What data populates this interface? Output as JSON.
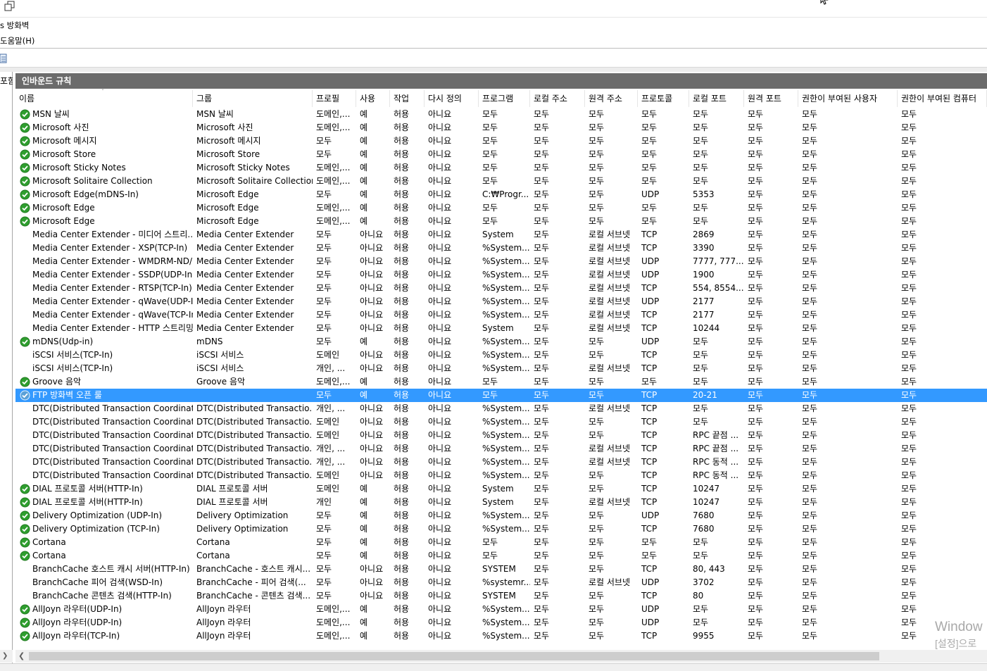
{
  "window": {
    "app_title": "s 방화벽",
    "menu_help": "도움말(H)",
    "left_pane_label": "포함"
  },
  "panel": {
    "title": "인바운드 규칙"
  },
  "columns": [
    "이름",
    "그룹",
    "프로필",
    "사용",
    "작업",
    "다시 정의",
    "프로그램",
    "로컬 주소",
    "원격 주소",
    "프로토콜",
    "로컬 포트",
    "원격 포트",
    "권한이 부여된 사용자",
    "권한이 부여된 컴퓨터"
  ],
  "rows": [
    {
      "enabled": true,
      "cells": [
        "MSN 날씨",
        "MSN 날씨",
        "도메인,...",
        "예",
        "허용",
        "아니요",
        "모두",
        "모두",
        "모두",
        "모두",
        "모두",
        "모두",
        "모두",
        "모두"
      ]
    },
    {
      "enabled": true,
      "cells": [
        "Microsoft 사진",
        "Microsoft 사진",
        "도메인,...",
        "예",
        "허용",
        "아니요",
        "모두",
        "모두",
        "모두",
        "모두",
        "모두",
        "모두",
        "모두",
        "모두"
      ]
    },
    {
      "enabled": true,
      "cells": [
        "Microsoft 메시지",
        "Microsoft 메시지",
        "모두",
        "예",
        "허용",
        "아니요",
        "모두",
        "모두",
        "모두",
        "모두",
        "모두",
        "모두",
        "모두",
        "모두"
      ]
    },
    {
      "enabled": true,
      "cells": [
        "Microsoft Store",
        "Microsoft Store",
        "모두",
        "예",
        "허용",
        "아니요",
        "모두",
        "모두",
        "모두",
        "모두",
        "모두",
        "모두",
        "모두",
        "모두"
      ]
    },
    {
      "enabled": true,
      "cells": [
        "Microsoft Sticky Notes",
        "Microsoft Sticky Notes",
        "도메인,...",
        "예",
        "허용",
        "아니요",
        "모두",
        "모두",
        "모두",
        "모두",
        "모두",
        "모두",
        "모두",
        "모두"
      ]
    },
    {
      "enabled": true,
      "cells": [
        "Microsoft Solitaire Collection",
        "Microsoft Solitaire Collection",
        "도메인,...",
        "예",
        "허용",
        "아니요",
        "모두",
        "모두",
        "모두",
        "모두",
        "모두",
        "모두",
        "모두",
        "모두"
      ]
    },
    {
      "enabled": true,
      "cells": [
        "Microsoft Edge(mDNS-In)",
        "Microsoft Edge",
        "모두",
        "예",
        "허용",
        "아니요",
        "C:₩Progr...",
        "모두",
        "모두",
        "UDP",
        "5353",
        "모두",
        "모두",
        "모두"
      ]
    },
    {
      "enabled": true,
      "cells": [
        "Microsoft Edge",
        "Microsoft Edge",
        "도메인,...",
        "예",
        "허용",
        "아니요",
        "모두",
        "모두",
        "모두",
        "모두",
        "모두",
        "모두",
        "모두",
        "모두"
      ]
    },
    {
      "enabled": true,
      "cells": [
        "Microsoft Edge",
        "Microsoft Edge",
        "도메인,...",
        "예",
        "허용",
        "아니요",
        "모두",
        "모두",
        "모두",
        "모두",
        "모두",
        "모두",
        "모두",
        "모두"
      ]
    },
    {
      "enabled": false,
      "cells": [
        "Media Center Extender - 미디어 스트리...",
        "Media Center Extender",
        "모두",
        "아니요",
        "허용",
        "아니요",
        "System",
        "모두",
        "로컬 서브넷",
        "TCP",
        "2869",
        "모두",
        "모두",
        "모두"
      ]
    },
    {
      "enabled": false,
      "cells": [
        "Media Center Extender - XSP(TCP-In)",
        "Media Center Extender",
        "모두",
        "아니요",
        "허용",
        "아니요",
        "%System...",
        "모두",
        "로컬 서브넷",
        "TCP",
        "3390",
        "모두",
        "모두",
        "모두"
      ]
    },
    {
      "enabled": false,
      "cells": [
        "Media Center Extender - WMDRM-ND/...",
        "Media Center Extender",
        "모두",
        "아니요",
        "허용",
        "아니요",
        "%System...",
        "모두",
        "로컬 서브넷",
        "UDP",
        "7777, 777...",
        "모두",
        "모두",
        "모두"
      ]
    },
    {
      "enabled": false,
      "cells": [
        "Media Center Extender - SSDP(UDP-In)",
        "Media Center Extender",
        "모두",
        "아니요",
        "허용",
        "아니요",
        "%System...",
        "모두",
        "로컬 서브넷",
        "UDP",
        "1900",
        "모두",
        "모두",
        "모두"
      ]
    },
    {
      "enabled": false,
      "cells": [
        "Media Center Extender - RTSP(TCP-In)",
        "Media Center Extender",
        "모두",
        "아니요",
        "허용",
        "아니요",
        "%System...",
        "모두",
        "로컬 서브넷",
        "TCP",
        "554, 8554...",
        "모두",
        "모두",
        "모두"
      ]
    },
    {
      "enabled": false,
      "cells": [
        "Media Center Extender - qWave(UDP-In)",
        "Media Center Extender",
        "모두",
        "아니요",
        "허용",
        "아니요",
        "%System...",
        "모두",
        "로컬 서브넷",
        "UDP",
        "2177",
        "모두",
        "모두",
        "모두"
      ]
    },
    {
      "enabled": false,
      "cells": [
        "Media Center Extender - qWave(TCP-In)",
        "Media Center Extender",
        "모두",
        "아니요",
        "허용",
        "아니요",
        "%System...",
        "모두",
        "로컬 서브넷",
        "TCP",
        "2177",
        "모두",
        "모두",
        "모두"
      ]
    },
    {
      "enabled": false,
      "cells": [
        "Media Center Extender - HTTP 스트리밍...",
        "Media Center Extender",
        "모두",
        "아니요",
        "허용",
        "아니요",
        "System",
        "모두",
        "로컬 서브넷",
        "TCP",
        "10244",
        "모두",
        "모두",
        "모두"
      ]
    },
    {
      "enabled": true,
      "cells": [
        "mDNS(Udp-in)",
        "mDNS",
        "모두",
        "예",
        "허용",
        "아니요",
        "%System...",
        "모두",
        "모두",
        "UDP",
        "모두",
        "모두",
        "모두",
        "모두"
      ]
    },
    {
      "enabled": false,
      "cells": [
        "iSCSI 서비스(TCP-In)",
        "iSCSI 서비스",
        "도메인",
        "아니요",
        "허용",
        "아니요",
        "%System...",
        "모두",
        "모두",
        "TCP",
        "모두",
        "모두",
        "모두",
        "모두"
      ]
    },
    {
      "enabled": false,
      "cells": [
        "iSCSI 서비스(TCP-In)",
        "iSCSI 서비스",
        "개인, ...",
        "아니요",
        "허용",
        "아니요",
        "%System...",
        "모두",
        "로컬 서브넷",
        "TCP",
        "모두",
        "모두",
        "모두",
        "모두"
      ]
    },
    {
      "enabled": true,
      "cells": [
        "Groove 음악",
        "Groove 음악",
        "도메인,...",
        "예",
        "허용",
        "아니요",
        "모두",
        "모두",
        "모두",
        "모두",
        "모두",
        "모두",
        "모두",
        "모두"
      ]
    },
    {
      "enabled": true,
      "selected": true,
      "cells": [
        "FTP 방화벽 오픈 룰",
        "",
        "모두",
        "예",
        "허용",
        "아니요",
        "모두",
        "모두",
        "모두",
        "TCP",
        "20-21",
        "모두",
        "모두",
        "모두"
      ]
    },
    {
      "enabled": false,
      "cells": [
        "DTC(Distributed Transaction Coordinato...",
        "DTC(Distributed Transactio...",
        "개인, ...",
        "아니요",
        "허용",
        "아니요",
        "%System...",
        "모두",
        "로컬 서브넷",
        "TCP",
        "모두",
        "모두",
        "모두",
        "모두"
      ]
    },
    {
      "enabled": false,
      "cells": [
        "DTC(Distributed Transaction Coordinato...",
        "DTC(Distributed Transactio...",
        "도메인",
        "아니요",
        "허용",
        "아니요",
        "%System...",
        "모두",
        "모두",
        "TCP",
        "모두",
        "모두",
        "모두",
        "모두"
      ]
    },
    {
      "enabled": false,
      "cells": [
        "DTC(Distributed Transaction Coordinato...",
        "DTC(Distributed Transactio...",
        "도메인",
        "아니요",
        "허용",
        "아니요",
        "%System...",
        "모두",
        "모두",
        "TCP",
        "RPC 끝점 ...",
        "모두",
        "모두",
        "모두"
      ]
    },
    {
      "enabled": false,
      "cells": [
        "DTC(Distributed Transaction Coordinato...",
        "DTC(Distributed Transactio...",
        "개인, ...",
        "아니요",
        "허용",
        "아니요",
        "%System...",
        "모두",
        "로컬 서브넷",
        "TCP",
        "RPC 끝점 ...",
        "모두",
        "모두",
        "모두"
      ]
    },
    {
      "enabled": false,
      "cells": [
        "DTC(Distributed Transaction Coordinato...",
        "DTC(Distributed Transactio...",
        "개인, ...",
        "아니요",
        "허용",
        "아니요",
        "%System...",
        "모두",
        "로컬 서브넷",
        "TCP",
        "RPC 동적 ...",
        "모두",
        "모두",
        "모두"
      ]
    },
    {
      "enabled": false,
      "cells": [
        "DTC(Distributed Transaction Coordinato...",
        "DTC(Distributed Transactio...",
        "도메인",
        "아니요",
        "허용",
        "아니요",
        "%System...",
        "모두",
        "모두",
        "TCP",
        "RPC 동적 ...",
        "모두",
        "모두",
        "모두"
      ]
    },
    {
      "enabled": true,
      "cells": [
        "DIAL 프로토콜 서버(HTTP-In)",
        "DIAL 프로토콜 서버",
        "도메인",
        "예",
        "허용",
        "아니요",
        "System",
        "모두",
        "모두",
        "TCP",
        "10247",
        "모두",
        "모두",
        "모두"
      ]
    },
    {
      "enabled": true,
      "cells": [
        "DIAL 프로토콜 서버(HTTP-In)",
        "DIAL 프로토콜 서버",
        "개인",
        "예",
        "허용",
        "아니요",
        "System",
        "모두",
        "로컬 서브넷",
        "TCP",
        "10247",
        "모두",
        "모두",
        "모두"
      ]
    },
    {
      "enabled": true,
      "cells": [
        "Delivery Optimization (UDP-In)",
        "Delivery Optimization",
        "모두",
        "예",
        "허용",
        "아니요",
        "%System...",
        "모두",
        "모두",
        "UDP",
        "7680",
        "모두",
        "모두",
        "모두"
      ]
    },
    {
      "enabled": true,
      "cells": [
        "Delivery Optimization (TCP-In)",
        "Delivery Optimization",
        "모두",
        "예",
        "허용",
        "아니요",
        "%System...",
        "모두",
        "모두",
        "TCP",
        "7680",
        "모두",
        "모두",
        "모두"
      ]
    },
    {
      "enabled": true,
      "cells": [
        "Cortana",
        "Cortana",
        "모두",
        "예",
        "허용",
        "아니요",
        "모두",
        "모두",
        "모두",
        "모두",
        "모두",
        "모두",
        "모두",
        "모두"
      ]
    },
    {
      "enabled": true,
      "cells": [
        "Cortana",
        "Cortana",
        "모두",
        "예",
        "허용",
        "아니요",
        "모두",
        "모두",
        "모두",
        "모두",
        "모두",
        "모두",
        "모두",
        "모두"
      ]
    },
    {
      "enabled": false,
      "cells": [
        "BranchCache 호스트 캐시 서버(HTTP-In)",
        "BranchCache - 호스트 캐시...",
        "모두",
        "아니요",
        "허용",
        "아니요",
        "SYSTEM",
        "모두",
        "모두",
        "TCP",
        "80, 443",
        "모두",
        "모두",
        "모두"
      ]
    },
    {
      "enabled": false,
      "cells": [
        "BranchCache 피어 검색(WSD-In)",
        "BranchCache - 피어 검색(...",
        "모두",
        "아니요",
        "허용",
        "아니요",
        "%systemr...",
        "모두",
        "로컬 서브넷",
        "UDP",
        "3702",
        "모두",
        "모두",
        "모두"
      ]
    },
    {
      "enabled": false,
      "cells": [
        "BranchCache 콘텐츠 검색(HTTP-In)",
        "BranchCache - 콘텐츠 검색...",
        "모두",
        "아니요",
        "허용",
        "아니요",
        "SYSTEM",
        "모두",
        "모두",
        "TCP",
        "80",
        "모두",
        "모두",
        "모두"
      ]
    },
    {
      "enabled": true,
      "cells": [
        "AllJoyn 라우터(UDP-In)",
        "AllJoyn 라우터",
        "도메인,...",
        "예",
        "허용",
        "아니요",
        "%System...",
        "모두",
        "모두",
        "UDP",
        "모두",
        "모두",
        "모두",
        "모두"
      ]
    },
    {
      "enabled": true,
      "cells": [
        "AllJoyn 라우터(UDP-In)",
        "AllJoyn 라우터",
        "도메인,...",
        "예",
        "허용",
        "아니요",
        "%System...",
        "모두",
        "모두",
        "UDP",
        "모두",
        "모두",
        "모두",
        "모두"
      ]
    },
    {
      "enabled": true,
      "cells": [
        "AllJoyn 라우터(TCP-In)",
        "AllJoyn 라우터",
        "도메인,...",
        "예",
        "허용",
        "아니요",
        "%System...",
        "모두",
        "모두",
        "TCP",
        "9955",
        "모두",
        "모두",
        "모두"
      ]
    }
  ],
  "watermark": {
    "line1": "Window",
    "line2": "[설정]으로"
  },
  "colors": {
    "selection": "#3399ff",
    "header_band": "#6b6b6b",
    "enabled_check": "#2f9e2f"
  },
  "icons": {
    "enabled": "check-circle-icon",
    "restore": "restore-window-icon"
  }
}
